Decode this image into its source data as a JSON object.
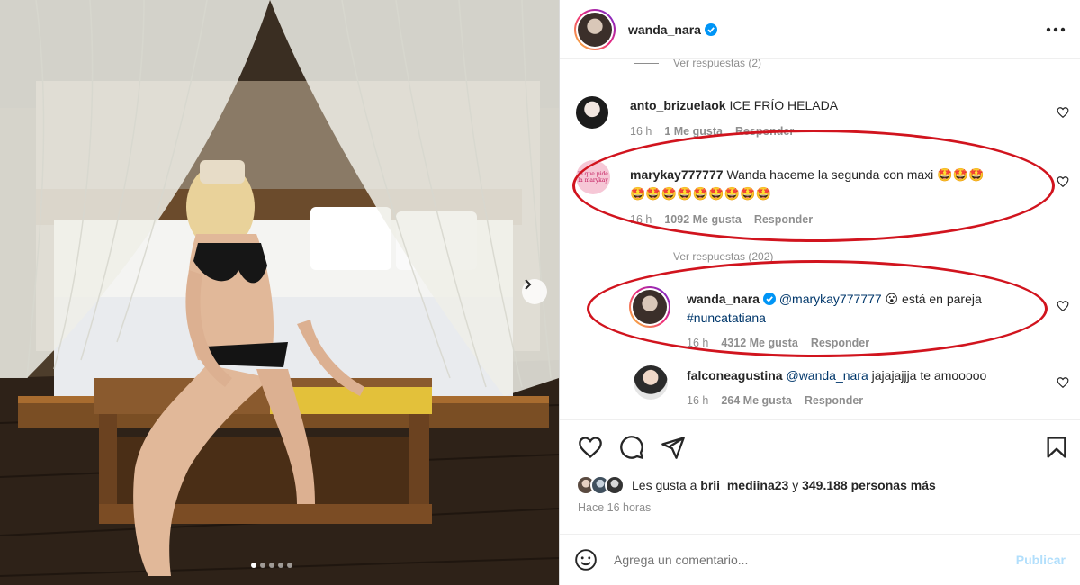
{
  "post": {
    "author": "wanda_nara",
    "slide_count": 5,
    "active_slide": 1
  },
  "comments": {
    "top_view_replies": "Ver respuestas (2)",
    "items": [
      {
        "user": "anto_brizuelaok",
        "text": "ICE FRÍO HELADA",
        "time": "16 h",
        "likes": "1 Me gusta",
        "reply": "Responder"
      },
      {
        "user": "marykay777777",
        "text_line1": "Wanda haceme la segunda con maxi 🤩🤩🤩",
        "text_line2": "🤩🤩🤩🤩🤩🤩🤩🤩🤩",
        "time": "16 h",
        "likes": "1092 Me gusta",
        "reply": "Responder",
        "avatar_text": "lo que pide la marykay"
      },
      {
        "view_replies": "Ver respuestas (202)"
      },
      {
        "user": "wanda_nara",
        "mention": "@marykay777777",
        "emoji": "😮",
        "text": "está en pareja",
        "hashtag": "#nuncatatiana",
        "time": "16 h",
        "likes": "4312 Me gusta",
        "reply": "Responder"
      },
      {
        "user": "falconeagustina",
        "mention": "@wanda_nara",
        "text": "jajajajjja te amooooo",
        "time": "16 h",
        "likes": "264 Me gusta",
        "reply": "Responder"
      }
    ]
  },
  "likes": {
    "prefix": "Les gusta a",
    "user": "brii_mediina23",
    "connector": "y",
    "others": "349.188 personas más"
  },
  "time_ago": "Hace 16 horas",
  "composer": {
    "placeholder": "Agrega un comentario...",
    "publish": "Publicar"
  },
  "colors": {
    "verified": "#0095f6",
    "annotation": "#d1141e",
    "link": "#00376b",
    "muted": "#8e8e8e"
  }
}
